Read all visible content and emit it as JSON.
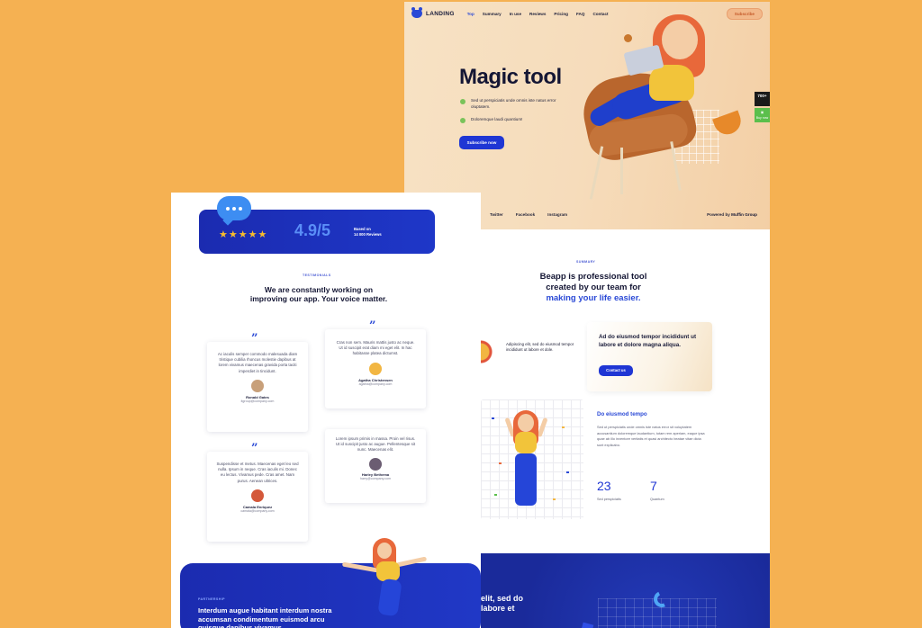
{
  "landing": {
    "nav": {
      "logo": "LANDING",
      "links": [
        "Top",
        "Summary",
        "In use",
        "Reviews",
        "Pricing",
        "FAQ",
        "Contact"
      ],
      "subscribe": "Subscribe"
    },
    "hero": {
      "title": "Magic tool",
      "bullets": [
        "Sed ut perspiciatis unde omnis iste natus error oluptatem.",
        "Doloremque laudi quantium!"
      ],
      "cta": "Subscribe now",
      "social": [
        "Twitter",
        "Facebook",
        "Instagram"
      ],
      "powered_by": "Powered by",
      "powered_name": "Muffin Group",
      "badge_count": "700+",
      "badge_buy": "Buy now"
    },
    "summary": {
      "label": "SUMMARY",
      "heading_line1": "Beapp is professional tool",
      "heading_line2": "created by our team for",
      "heading_highlight": "making your life easier.",
      "feature_text": "Adipiscing elit, sed do eiusmod tempor incididunt ut labore et dole.",
      "card_text": "Ad do eiusmod tempor incididunt ut labore et dolore magna aliqua.",
      "card_button": "Contact us",
      "block_title": "Do eiusmod tempo",
      "block_text": "Sed ut perspiciatis unde omnis iste natus error sit voluptatem accusantium doloremque laudantium, totam rem aperiam, eaque ipsa quae ab illo inventore veritatis et quasi architecto beatae vitae dicta sunt explicabo.",
      "stats": [
        {
          "value": "23",
          "label": "Sed perspiciatis"
        },
        {
          "value": "7",
          "label": "Quantum"
        }
      ],
      "band_text_line1": "elit, sed do",
      "band_text_line2": "labore et"
    }
  },
  "reviews": {
    "rating_value": "4.9/5",
    "stars": "★★★★★",
    "rating_sub_line1": "Based on",
    "rating_sub_line2": "14 000 Reviews",
    "label": "TESTIMONIALS",
    "heading": "We are constantly working on improving our app. Your voice matter.",
    "testimonials": [
      {
        "text": "Ac iaculis semper commodo malesuada diam tristique cubilia rhoncus molestie dapibus at lorem vivamus maecenas gravida porta taciti imperdiet in tincidunt.",
        "name": "Ronald Gates",
        "email": "itgroup@company.com"
      },
      {
        "text": "Cras non sem. Mauris mattis justo ac neque. Ut id suscipit erat diam mi eget elit. In hac habitasse platea dictumst.",
        "name": "Agatha Christensen",
        "email": "agatha@company.com"
      },
      {
        "text": "Lorem ipsum primis in massa. Proin vel risus. Ut id suscipit justo ac augue. Pellentesque sit nunc. Maecenas elit.",
        "name": "Harley Bethema",
        "email": "harry@company.com"
      },
      {
        "text": "Suspendisse et metus. Maecenas eget leo sed nulla. Ipsum in neque. Cras iaculis mi. Donec eu lectus. Vivamus pede. Cras amet. Nam purus. Aenean ultrices.",
        "name": "Camala Enriquez",
        "email": "camala@company.com"
      }
    ],
    "banner_label": "PARTNERSHIP",
    "banner_text": "Interdum augue habitant interdum nostra accumsan condimentum euismod arcu quisque dapibus vivamus"
  },
  "colors": {
    "background": "#f5b152",
    "accent_blue": "#1f36d4",
    "star": "#f8bd2c"
  }
}
